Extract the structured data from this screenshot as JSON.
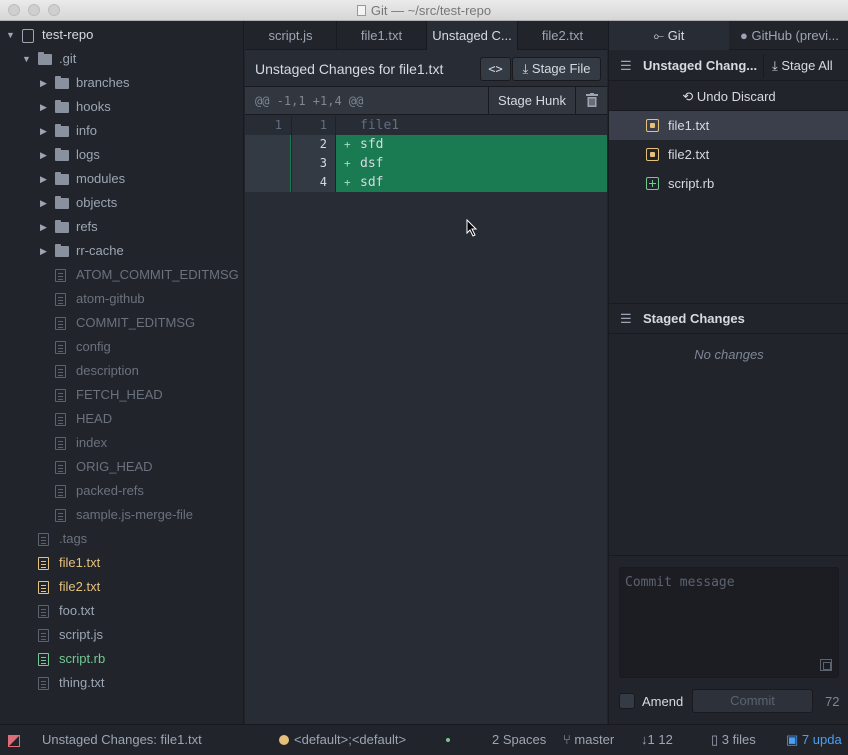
{
  "window": {
    "title": "Git — ~/src/test-repo"
  },
  "tree": {
    "root": "test-repo",
    "git_folder": ".git",
    "git_subfolders": [
      "branches",
      "hooks",
      "info",
      "logs",
      "modules",
      "objects",
      "refs",
      "rr-cache"
    ],
    "git_files": [
      "ATOM_COMMIT_EDITMSG",
      "atom-github",
      "COMMIT_EDITMSG",
      "config",
      "description",
      "FETCH_HEAD",
      "HEAD",
      "index",
      "ORIG_HEAD",
      "packed-refs",
      "sample.js-merge-file"
    ],
    "root_files": [
      {
        "name": ".tags",
        "status": "ignored"
      },
      {
        "name": "file1.txt",
        "status": "modified"
      },
      {
        "name": "file2.txt",
        "status": "modified"
      },
      {
        "name": "foo.txt",
        "status": "normal"
      },
      {
        "name": "script.js",
        "status": "normal"
      },
      {
        "name": "script.rb",
        "status": "added"
      },
      {
        "name": "thing.txt",
        "status": "normal"
      }
    ]
  },
  "tabs": [
    "script.js",
    "file1.txt",
    "Unstaged C...",
    "file2.txt"
  ],
  "active_tab": "Unstaged C...",
  "diff": {
    "title": "Unstaged Changes for file1.txt",
    "toggle_label": "<>",
    "stage_file": "Stage File",
    "hunk_header": "@@ -1,1 +1,4 @@",
    "stage_hunk": "Stage Hunk",
    "lines": [
      {
        "old": "1",
        "new": "1",
        "marker": "",
        "text": "file1",
        "kind": "ctx"
      },
      {
        "old": "",
        "new": "2",
        "marker": "+",
        "text": "sfd",
        "kind": "add"
      },
      {
        "old": "",
        "new": "3",
        "marker": "+",
        "text": "dsf",
        "kind": "add"
      },
      {
        "old": "",
        "new": "4",
        "marker": "+",
        "text": "sdf",
        "kind": "add"
      }
    ]
  },
  "git": {
    "tab_git": "Git",
    "tab_github": "GitHub (previ...",
    "unstaged_title": "Unstaged Chang...",
    "stage_all": "Stage All",
    "undo_discard": "Undo Discard",
    "unstaged_files": [
      {
        "name": "file1.txt",
        "status": "modified"
      },
      {
        "name": "file2.txt",
        "status": "modified"
      },
      {
        "name": "script.rb",
        "status": "added"
      }
    ],
    "staged_title": "Staged Changes",
    "no_changes": "No changes",
    "commit_placeholder": "Commit message",
    "amend": "Amend",
    "commit": "Commit",
    "char_count": "72"
  },
  "status": {
    "file": "Unstaged Changes: file1.txt",
    "grammar": "<default>;<default>",
    "indent": "2 Spaces",
    "branch": "master",
    "ahead_behind": "1  12",
    "files": "3 files",
    "updates": "7 upda"
  },
  "colors": {
    "added": "#73c990",
    "modified": "#e5c07b",
    "accent": "#4a9ff5"
  }
}
